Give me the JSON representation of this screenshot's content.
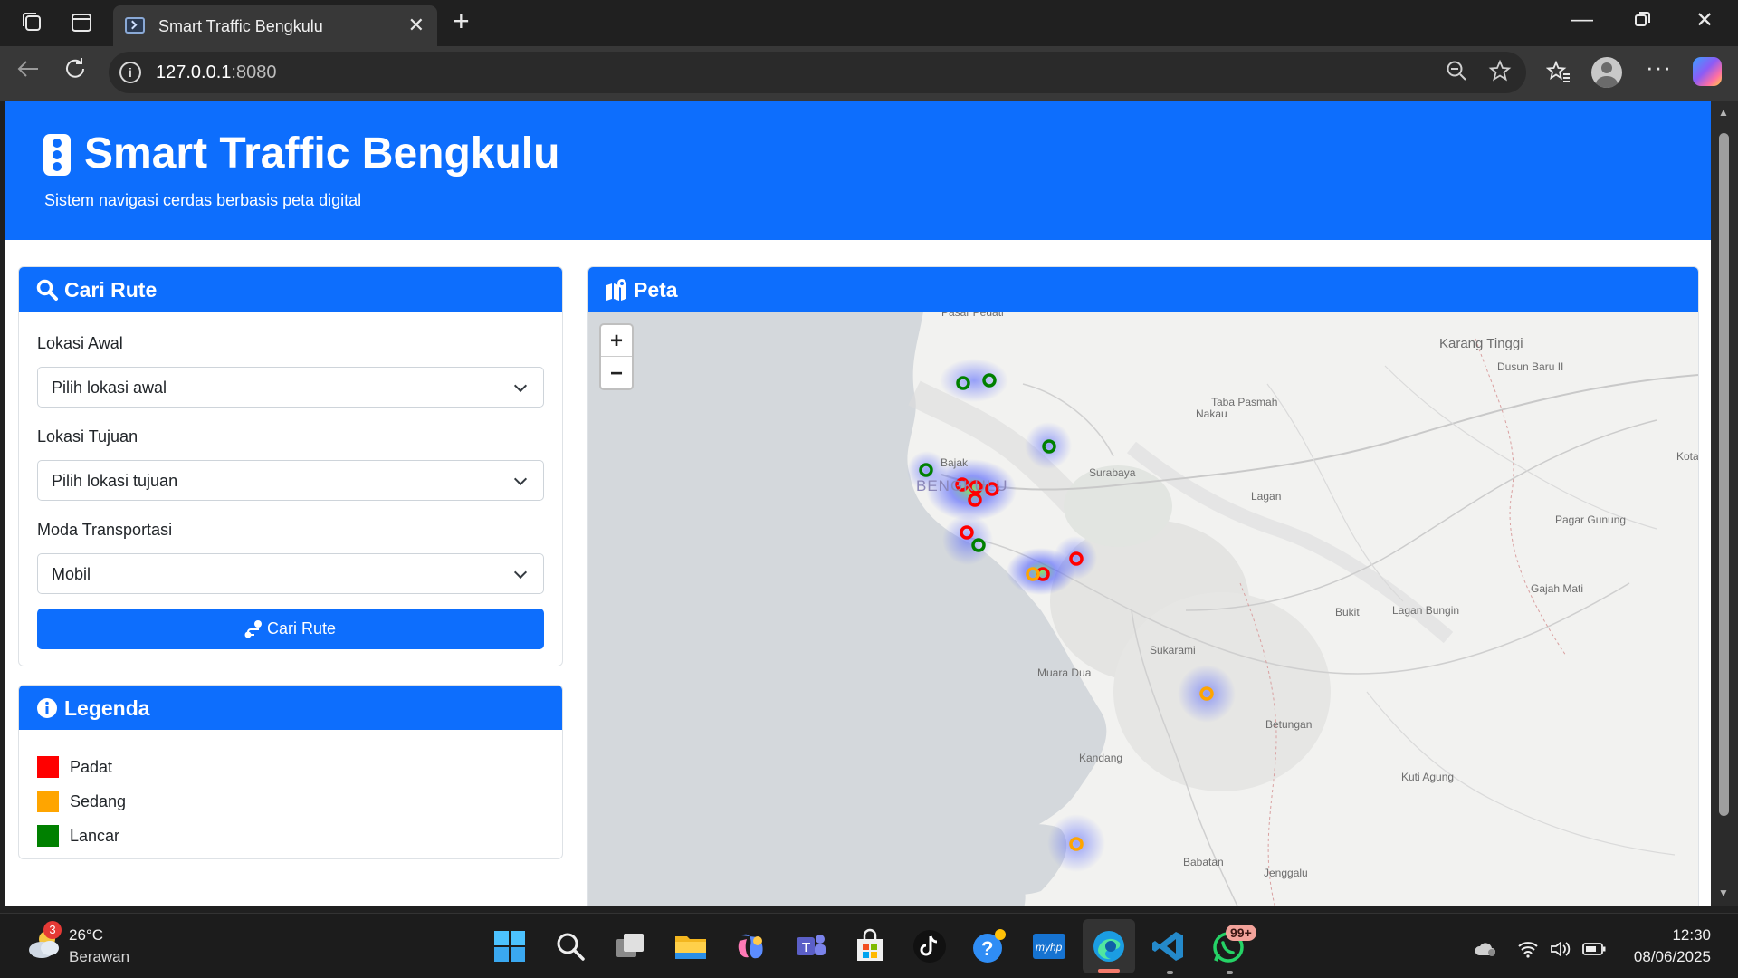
{
  "browser": {
    "tab_title": "Smart Traffic Bengkulu",
    "url_host": "127.0.0.1",
    "url_port": ":8080"
  },
  "header": {
    "title": "Smart Traffic Bengkulu",
    "subtitle": "Sistem navigasi cerdas berbasis peta digital"
  },
  "search_card": {
    "title": "Cari Rute",
    "origin_label": "Lokasi Awal",
    "origin_value": "Pilih lokasi awal",
    "destination_label": "Lokasi Tujuan",
    "destination_value": "Pilih lokasi tujuan",
    "mode_label": "Moda Transportasi",
    "mode_value": "Mobil",
    "submit_label": "Cari Rute"
  },
  "legend_card": {
    "title": "Legenda",
    "items": [
      {
        "label": "Padat",
        "color": "#ff0000"
      },
      {
        "label": "Sedang",
        "color": "#ffa500"
      },
      {
        "label": "Lancar",
        "color": "#008000"
      }
    ]
  },
  "map_card": {
    "title": "Peta",
    "zoom_in": "+",
    "zoom_out": "−",
    "place_labels": [
      "Pasar Pedati",
      "Karang Tinggi",
      "Dusun Baru II",
      "Taba Pasmah",
      "Nakau",
      "Bajak",
      "BENGKULU",
      "Surabaya",
      "Lagan",
      "Kota",
      "Pagar Gunung",
      "Gajah Mati",
      "Bukit",
      "Lagan Bungin",
      "Sukarami",
      "Muara Dua",
      "Betungan",
      "Kandang",
      "Kuti Agung",
      "Babatan",
      "Jenggalu"
    ],
    "status_colors": {
      "padat": "#ff0000",
      "sedang": "#ffa500",
      "lancar": "#008000"
    }
  },
  "taskbar": {
    "weather_badge": "3",
    "temperature": "26°C",
    "weather": "Berawan",
    "whatsapp_badge": "99+",
    "time": "12:30",
    "date": "08/06/2025"
  }
}
